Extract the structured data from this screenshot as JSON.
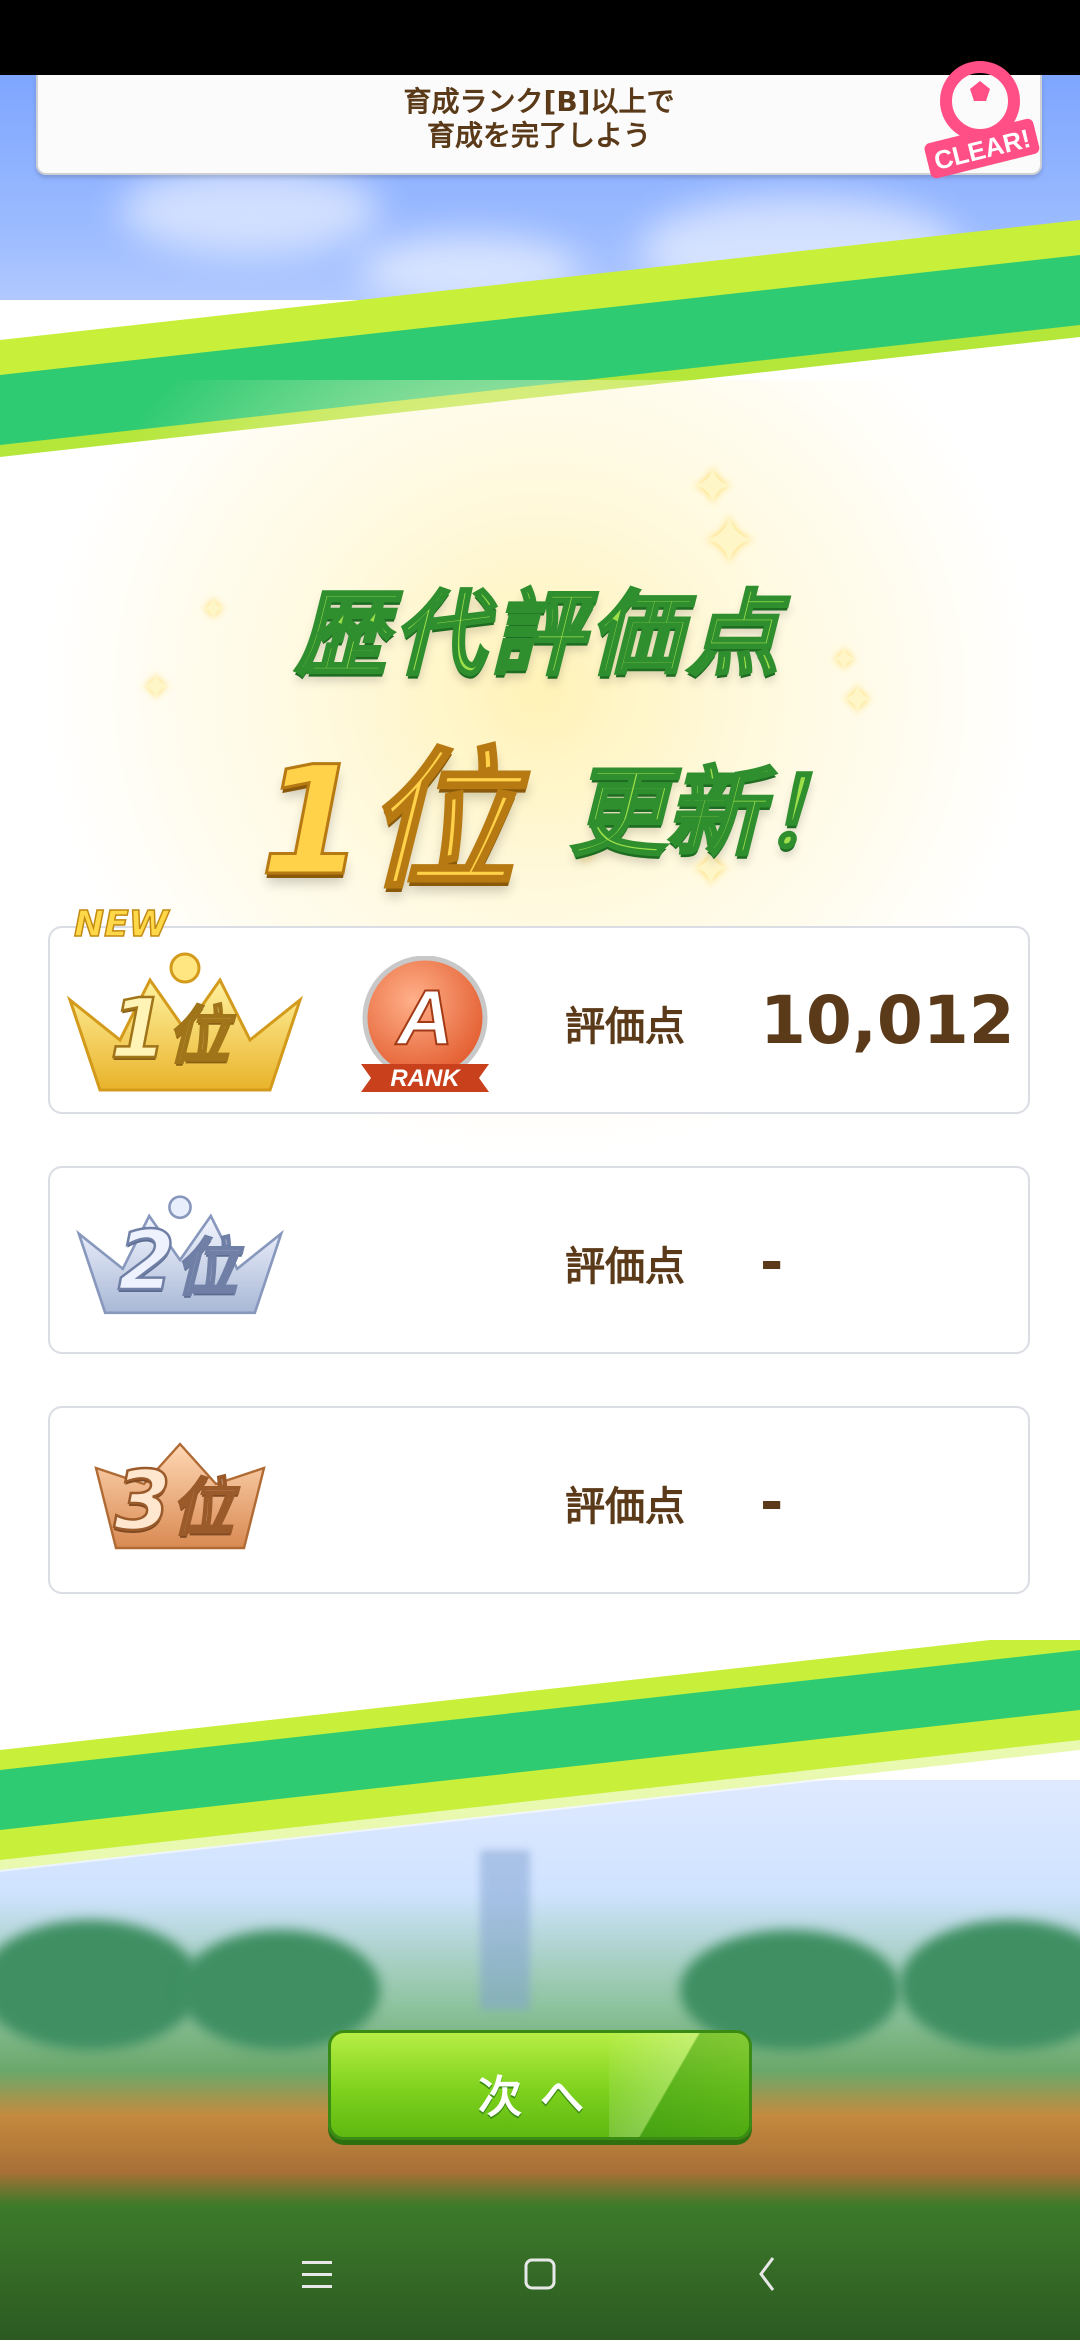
{
  "mission": {
    "line1": "育成ランク[B]以上で",
    "line2": "育成を完了しよう",
    "stamp": "CLEAR!"
  },
  "headline": {
    "line1": "歴代評価点",
    "rank_text": "1位",
    "update_text": "更新！"
  },
  "rankings": [
    {
      "place_num": "1",
      "place_suffix": "位",
      "new_tag": "NEW",
      "rank_letter": "A",
      "rank_word": "RANK",
      "label": "評価点",
      "score": "10,012"
    },
    {
      "place_num": "2",
      "place_suffix": "位",
      "label": "評価点",
      "score": "-"
    },
    {
      "place_num": "3",
      "place_suffix": "位",
      "label": "評価点",
      "score": "-"
    }
  ],
  "next_button": {
    "label": "次へ"
  },
  "navbar": {
    "menu_icon": "menu-icon",
    "home_icon": "home-icon",
    "back_icon": "back-icon"
  },
  "colors": {
    "title_green": "#9fe04a",
    "title_gold": "#ffd24a",
    "text_brown": "#5b3a1a",
    "button_green": "#7ed21d"
  }
}
